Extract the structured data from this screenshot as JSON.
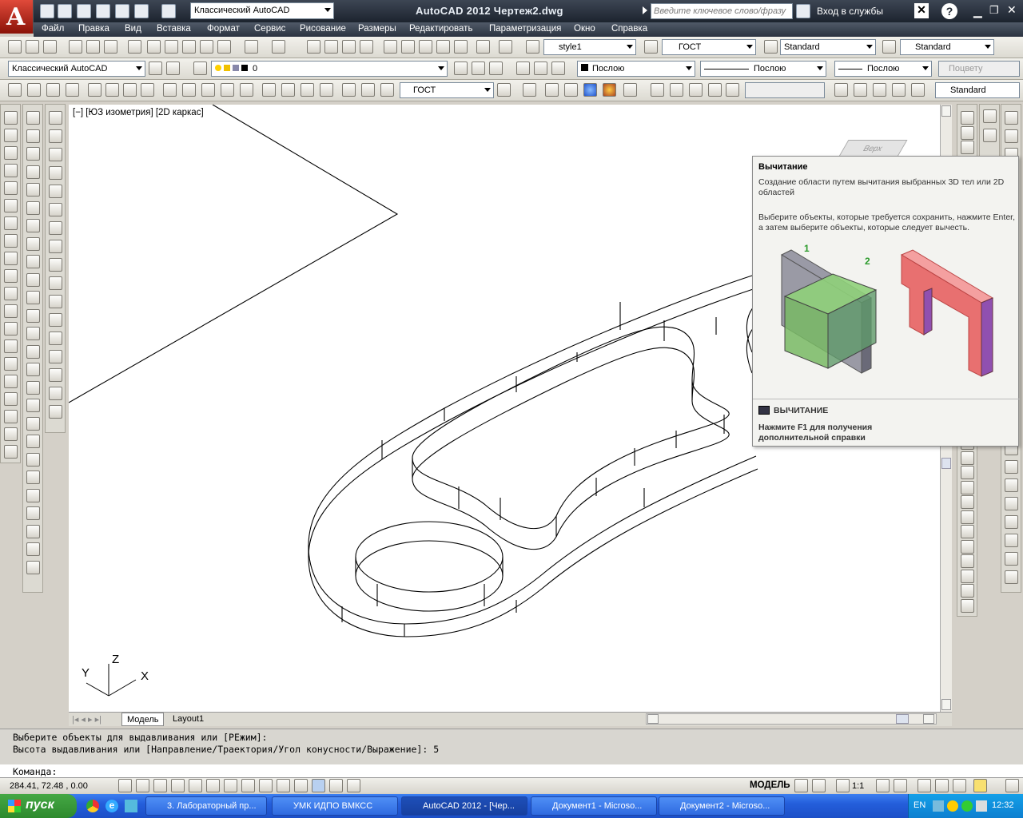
{
  "title_bar": {
    "workspace": "Классический AutoCAD",
    "app_title": "AutoCAD 2012    Чертеж2.dwg",
    "search_placeholder": "Введите ключевое слово/фразу",
    "service_login": "Вход в службы"
  },
  "menu": [
    "Файл",
    "Правка",
    "Вид",
    "Вставка",
    "Формат",
    "Сервис",
    "Рисование",
    "Размеры",
    "Редактировать",
    "Параметризация",
    "Окно",
    "Справка"
  ],
  "styles_toolbar": {
    "text_style": "style1",
    "dim_style": "ГОСТ",
    "table_style": "Standard",
    "mleader_style": "Standard"
  },
  "layers_toolbar": {
    "workspace": "Классический AutoCAD",
    "layer": "0",
    "color": "Послою",
    "linetype": "Послою",
    "lineweight": "Послою",
    "plot_style": "Поцвету"
  },
  "dim_toolbar": {
    "dim_style": "ГОСТ",
    "visual_style": "Standard"
  },
  "viewport": {
    "label": "[−] [ЮЗ изометрия] [2D каркас]",
    "ucs_x": "X",
    "ucs_y": "Y",
    "ucs_z": "Z",
    "viewcube_text": "Верх"
  },
  "tabs": {
    "model": "Модель",
    "layout1": "Layout1"
  },
  "command_line": {
    "line1": "Выберите объекты для выдавливания или [РЕжим]:",
    "line2": "Высота выдавливания или [Направление/Траектория/Угол конусности/Выражение]: 5",
    "prompt": "Команда:"
  },
  "status_bar": {
    "coords": "284.41, 72.48 , 0.00",
    "model": "МОДЕЛЬ",
    "scale": "1:1"
  },
  "tooltip": {
    "title": "Вычитание",
    "description": "Создание области путем вычитания выбранных 3D тел или 2D областей",
    "hint": "Выберите объекты, которые требуется сохранить, нажмите Enter, а затем выберите объекты, которые следует вычесть.",
    "label1": "1",
    "label2": "2",
    "command_name": "ВЫЧИТАНИЕ",
    "f1_help": "Нажмите F1 для получения дополнительной справки"
  },
  "taskbar": {
    "start": "пуск",
    "tasks": [
      "3. Лабораторный пр...",
      "УМК ИДПО ВМКСС",
      "AutoCAD 2012 - [Чер...",
      "Документ1 - Microso...",
      "Документ2 - Microso..."
    ],
    "lang": "EN",
    "clock": "12:32"
  },
  "colors": {
    "accent": "#245edb",
    "title_bg": "#2b3340"
  }
}
